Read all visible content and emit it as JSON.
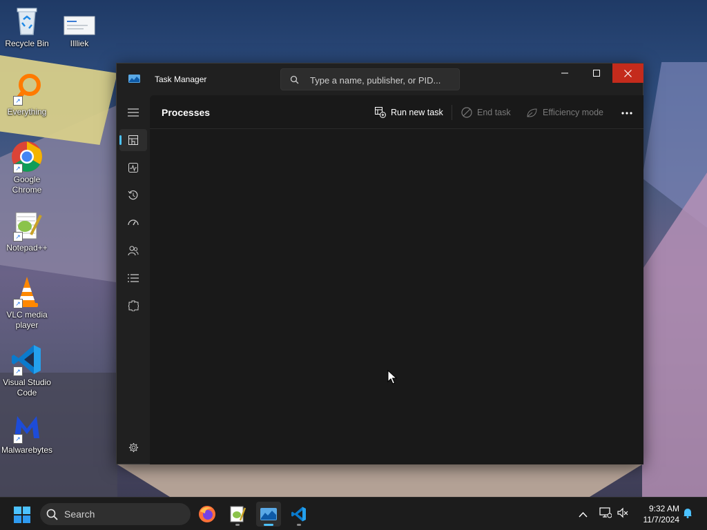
{
  "desktop": {
    "icons": [
      {
        "label": "Recycle Bin",
        "icon": "recycle-bin-icon"
      },
      {
        "label": "Illliek",
        "icon": "document-thumbnail-icon"
      },
      {
        "label": "Everything",
        "icon": "everything-search-icon"
      },
      {
        "label": "Google Chrome",
        "icon": "chrome-icon"
      },
      {
        "label": "Notepad++",
        "icon": "notepadplusplus-icon"
      },
      {
        "label": "VLC media player",
        "icon": "vlc-icon"
      },
      {
        "label": "Visual Studio Code",
        "icon": "vscode-icon"
      },
      {
        "label": "Malwarebytes",
        "icon": "malwarebytes-icon"
      }
    ]
  },
  "task_manager": {
    "title": "Task Manager",
    "search_placeholder": "Type a name, publisher, or PID...",
    "page_title": "Processes",
    "toolbar": {
      "run_new_task": "Run new task",
      "end_task": "End task",
      "efficiency_mode": "Efficiency mode"
    },
    "nav": [
      {
        "name": "processes",
        "icon": "processes-icon",
        "active": true
      },
      {
        "name": "performance",
        "icon": "performance-icon"
      },
      {
        "name": "app-history",
        "icon": "app-history-icon"
      },
      {
        "name": "startup-apps",
        "icon": "startup-icon"
      },
      {
        "name": "users",
        "icon": "users-icon"
      },
      {
        "name": "details",
        "icon": "details-icon"
      },
      {
        "name": "services",
        "icon": "services-icon"
      },
      {
        "name": "settings",
        "icon": "settings-icon"
      }
    ]
  },
  "taskbar": {
    "search_label": "Search",
    "apps": [
      "firefox-icon",
      "notepadplusplus-icon",
      "task-manager-icon",
      "vscode-icon"
    ],
    "clock": {
      "time": "9:32 AM",
      "date": "11/7/2024"
    }
  },
  "colors": {
    "accent": "#4cc2ff",
    "close_red": "#c42b1c",
    "tm_bg": "#202020",
    "content_bg": "#191919"
  }
}
